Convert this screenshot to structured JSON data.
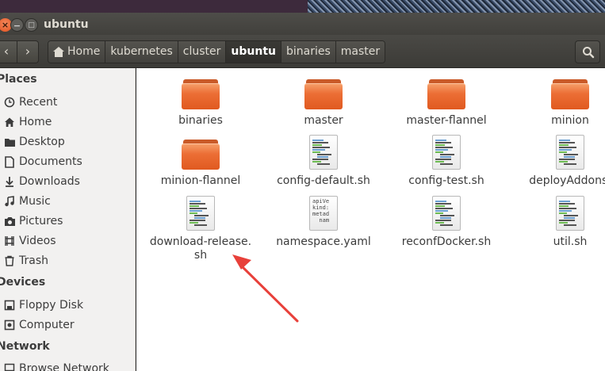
{
  "window": {
    "title": "ubuntu"
  },
  "toolbar": {
    "back_glyph": "‹",
    "forward_glyph": "›",
    "breadcrumbs": [
      "Home",
      "kubernetes",
      "cluster",
      "ubuntu",
      "binaries",
      "master"
    ],
    "active_crumb": "ubuntu"
  },
  "sidebar": {
    "places_header": "Places",
    "places": [
      {
        "label": "Recent",
        "icon": "clock-icon"
      },
      {
        "label": "Home",
        "icon": "home-icon"
      },
      {
        "label": "Desktop",
        "icon": "desktop-folder-icon"
      },
      {
        "label": "Documents",
        "icon": "documents-icon"
      },
      {
        "label": "Downloads",
        "icon": "download-arrow-icon"
      },
      {
        "label": "Music",
        "icon": "music-note-icon"
      },
      {
        "label": "Pictures",
        "icon": "camera-icon"
      },
      {
        "label": "Videos",
        "icon": "film-icon"
      },
      {
        "label": "Trash",
        "icon": "trash-icon"
      }
    ],
    "devices_header": "Devices",
    "devices": [
      {
        "label": "Floppy Disk",
        "icon": "floppy-icon"
      },
      {
        "label": "Computer",
        "icon": "computer-icon"
      }
    ],
    "network_header": "Network",
    "network": [
      {
        "label": "Browse Network",
        "icon": "network-icon"
      }
    ]
  },
  "files": [
    {
      "name": "binaries",
      "type": "folder"
    },
    {
      "name": "master",
      "type": "folder"
    },
    {
      "name": "master-flannel",
      "type": "folder"
    },
    {
      "name": "minion",
      "type": "folder"
    },
    {
      "name": "minion-flannel",
      "type": "folder"
    },
    {
      "name": "config-default.sh",
      "type": "script"
    },
    {
      "name": "config-test.sh",
      "type": "script"
    },
    {
      "name": "deployAddons.",
      "type": "script"
    },
    {
      "name": "download-release.",
      "name2": "sh",
      "type": "script"
    },
    {
      "name": "namespace.yaml",
      "type": "text",
      "preview": "apiVe\nkind:\nmetad\n  nam"
    },
    {
      "name": "reconfDocker.sh",
      "type": "script"
    },
    {
      "name": "util.sh",
      "type": "script"
    }
  ],
  "colors": {
    "accent_orange": "#ec6e35",
    "annotation_arrow": "#e8403a",
    "sidebar_bg": "#f2f1f0",
    "toolbar_bg": "#3c3b37"
  }
}
